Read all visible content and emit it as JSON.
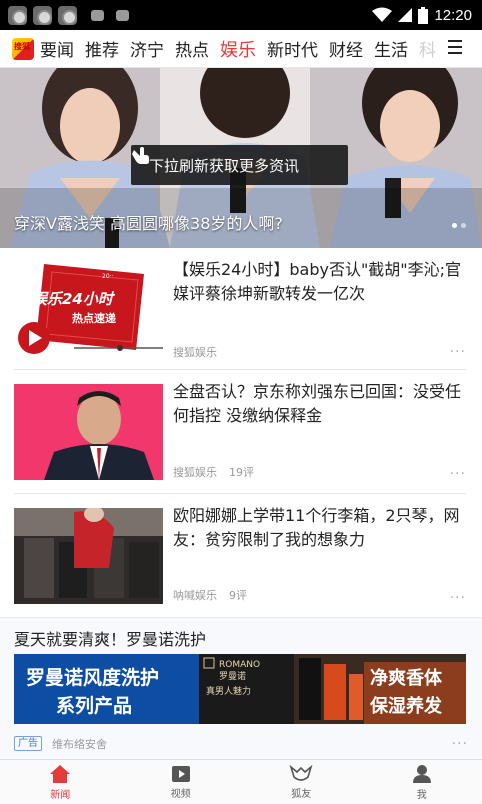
{
  "status_bar": {
    "time": "12:20",
    "icons": [
      "app-icon",
      "app-icon",
      "app-icon",
      "notification-icon",
      "notification-icon",
      "wifi-icon",
      "signal-icon",
      "battery-icon"
    ]
  },
  "channels": {
    "logo_text": "搜狐",
    "tabs": [
      "要闻",
      "推荐",
      "济宁",
      "热点",
      "娱乐",
      "新时代",
      "财经",
      "生活",
      "科"
    ],
    "active_index": 4,
    "accent_color": "#e53b3b"
  },
  "hero": {
    "caption": "穿深V露浅笑 高圆圆哪像38岁的人啊?",
    "refresh_toast": "下拉刷新获取更多资讯",
    "dots_total": 2,
    "dot_active": 0
  },
  "feed": [
    {
      "title": "【娱乐24小时】baby否认\"截胡\"李沁;官媒评蔡徐坤新歌转发一亿次",
      "source": "搜狐娱乐",
      "comments": "",
      "more": "...",
      "thumb": {
        "brand_line1": "娱乐24小时",
        "brand_line2": "热点速递",
        "badge": "20··"
      }
    },
    {
      "title": "全盘否认？京东称刘强东已回国：没受任何指控 没缴纳保释金",
      "source": "搜狐娱乐",
      "comments": "19评",
      "more": "..."
    },
    {
      "title": "欧阳娜娜上学带11个行李箱，2只琴，网友：贫穷限制了我的想象力",
      "source": "呐喊娱乐",
      "comments": "9评",
      "more": "..."
    }
  ],
  "ad": {
    "title": "夏天就要清爽！罗曼诺洗护",
    "banner_left": [
      "罗曼诺风度洗护",
      "系列产品"
    ],
    "banner_brand_en": "ROMANO",
    "banner_brand_cn": "罗曼诺",
    "banner_slogan": "真男人魅力",
    "banner_right": [
      "净爽香体",
      "保湿养发"
    ],
    "tag": "广告",
    "source": "维布络安舍",
    "more": "..."
  },
  "bottom_nav": [
    {
      "label": "新闻",
      "icon": "home-icon",
      "active": true
    },
    {
      "label": "视频",
      "icon": "video-icon",
      "active": false
    },
    {
      "label": "狐友",
      "icon": "fox-icon",
      "active": false
    },
    {
      "label": "我",
      "icon": "person-icon",
      "active": false
    }
  ]
}
